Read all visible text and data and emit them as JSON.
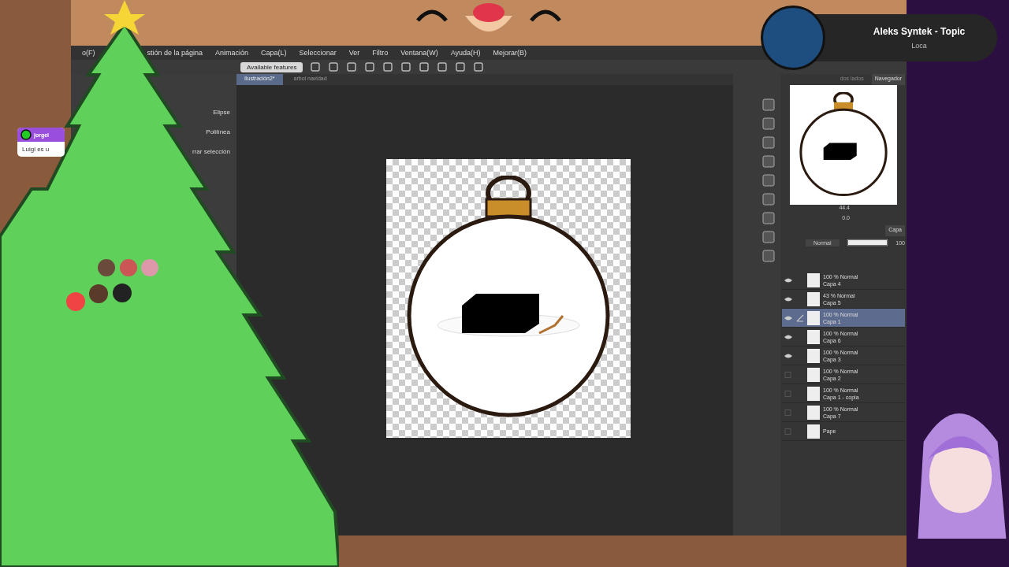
{
  "stream_overlay": {
    "now_playing": {
      "artist": "Aleks Syntek - Topic",
      "title": "Loca"
    },
    "chat_message": {
      "user": "jorgel",
      "text": "Luigi es u"
    }
  },
  "menu_bar": [
    "o(F)",
    "stión de la página",
    "Animación",
    "Capa(L)",
    "Seleccionar",
    "Ver",
    "Filtro",
    "Ventana(W)",
    "Ayuda(H)",
    "Mejorar(B)"
  ],
  "toolbar": {
    "notice": "Available features"
  },
  "document_tabs": [
    {
      "label": "Ilustración2*",
      "selected": true
    },
    {
      "label": "arbol navidad",
      "selected": false
    }
  ],
  "tool_options": [
    "Elipse",
    "Polilínea",
    "rrar selección"
  ],
  "navigator": {
    "tabs": [
      {
        "label": "dos lados",
        "selected": false
      },
      {
        "label": "Navegador",
        "selected": true
      }
    ],
    "zoom": "44.4",
    "rotation": "0.0"
  },
  "layer_panel": {
    "tab": "Capa",
    "blend_mode": "Normal",
    "opacity": "100",
    "opacity_slider": {
      "level": 1
    },
    "layers": [
      {
        "mode_line": "100 % Normal",
        "name": "Capa 4",
        "visible": true,
        "selected": false
      },
      {
        "mode_line": "43 % Normal",
        "name": "Capa 5",
        "visible": true,
        "selected": false
      },
      {
        "mode_line": "100 % Normal",
        "name": "Capa 1",
        "visible": true,
        "selected": true
      },
      {
        "mode_line": "100 % Normal",
        "name": "Capa 6",
        "visible": true,
        "selected": false
      },
      {
        "mode_line": "100 % Normal",
        "name": "Capa 3",
        "visible": true,
        "selected": false
      },
      {
        "mode_line": "100 % Normal",
        "name": "Capa 2",
        "visible": false,
        "selected": false
      },
      {
        "mode_line": "100 % Normal",
        "name": "Capa 1 - copia",
        "visible": false,
        "selected": false
      },
      {
        "mode_line": "100 % Normal",
        "name": "Capa 7",
        "visible": false,
        "selected": false
      },
      {
        "name": "Pape",
        "visible": false,
        "selected": false
      }
    ]
  }
}
